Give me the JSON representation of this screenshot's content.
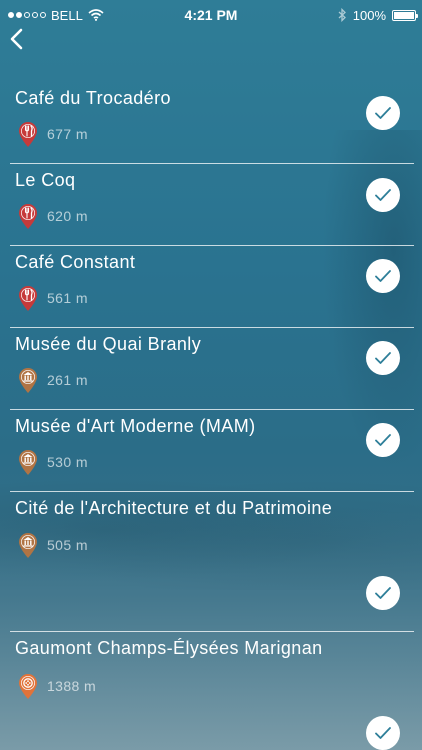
{
  "status_bar": {
    "carrier": "BELL",
    "time": "4:21 PM",
    "battery": "100%",
    "battery_level": 1.0,
    "signal_bars_filled": 2,
    "signal_bars_total": 5
  },
  "nav": {
    "back_icon": "chevron-left-icon"
  },
  "colors": {
    "restaurant_pin": "#c63a3a",
    "museum_pin": "#b07444",
    "cinema_pin": "#e0733a",
    "check_color": "#2e7f99"
  },
  "places": [
    {
      "name": "Café du Trocadéro",
      "distance": "677 m",
      "category": "restaurant",
      "icon": "fork-knife-icon",
      "checked": true
    },
    {
      "name": "Le Coq",
      "distance": "620 m",
      "category": "restaurant",
      "icon": "fork-knife-icon",
      "checked": true
    },
    {
      "name": "Café Constant",
      "distance": "561 m",
      "category": "restaurant",
      "icon": "fork-knife-icon",
      "checked": true
    },
    {
      "name": "Musée du Quai Branly",
      "distance": "261 m",
      "category": "museum",
      "icon": "museum-icon",
      "checked": true
    },
    {
      "name": "Musée d'Art Moderne (MAM)",
      "distance": "530 m",
      "category": "museum",
      "icon": "museum-icon",
      "checked": true
    },
    {
      "name": "Cité de l'Architecture et du Patrimoine",
      "distance": "505 m",
      "category": "museum",
      "icon": "museum-icon",
      "checked": true
    },
    {
      "name": "Gaumont Champs-Élysées Marignan",
      "distance": "1388 m",
      "category": "cinema",
      "icon": "film-icon",
      "checked": true
    }
  ]
}
